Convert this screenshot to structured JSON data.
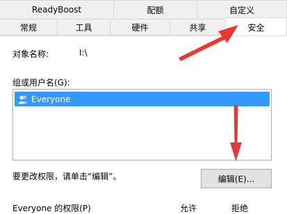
{
  "tabs_top": [
    "ReadyBoost",
    "配额",
    "自定义"
  ],
  "tabs_bottom": [
    "常规",
    "工具",
    "硬件",
    "共享",
    "安全"
  ],
  "active_tab": "安全",
  "object_name_label": "对象名称:",
  "object_name_value": "I:\\",
  "group_label": "组或用户名(G):",
  "users": [
    "Everyone"
  ],
  "change_hint": "要更改权限，请单击“编辑”。",
  "edit_button": "编辑(E)...",
  "permissions_label": "Everyone 的权限(P)",
  "allow_header": "允许",
  "deny_header": "拒绝",
  "colors": {
    "selection": "#3399ff",
    "annotation_arrow": "#e53935"
  }
}
